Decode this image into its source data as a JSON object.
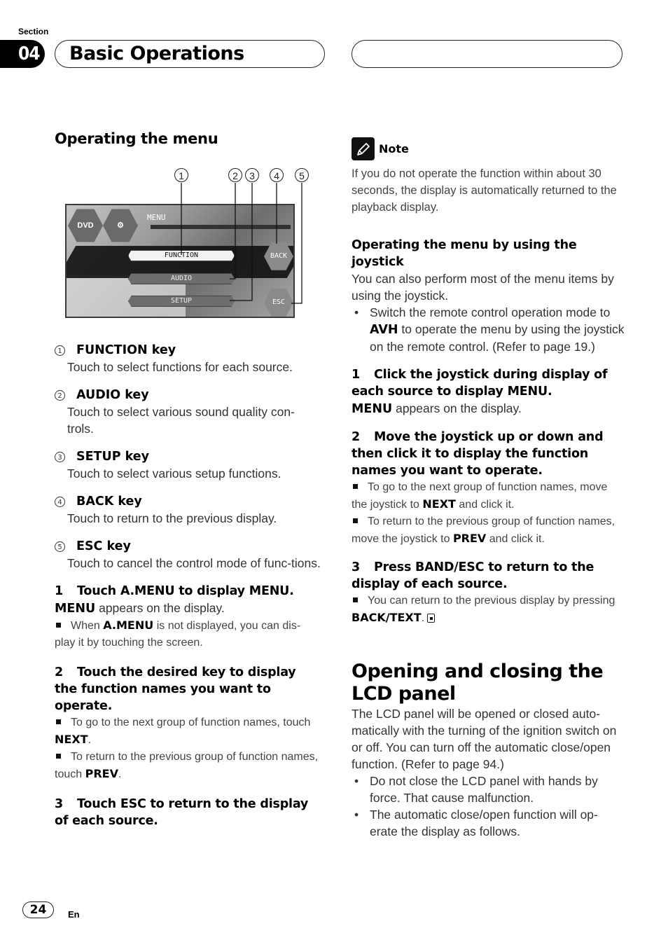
{
  "header": {
    "section_label": "Section",
    "section_number": "04",
    "section_title": "Basic Operations"
  },
  "left": {
    "heading": "Operating the menu",
    "figure": {
      "callouts": [
        "1",
        "2",
        "3",
        "4",
        "5"
      ],
      "screen": {
        "menu_label": "MENU",
        "source_icon_label": "DVD",
        "keys": [
          "FUNCTION",
          "AUDIO",
          "SETUP"
        ],
        "back_label": "BACK",
        "esc_label": "ESC"
      }
    },
    "key_items": [
      {
        "num": "1",
        "title": "FUNCTION key",
        "desc": "Touch to select functions for each source."
      },
      {
        "num": "2",
        "title": "AUDIO key",
        "desc": "Touch to select various sound quality con-trols."
      },
      {
        "num": "3",
        "title": "SETUP key",
        "desc": "Touch to select various setup functions."
      },
      {
        "num": "4",
        "title": "BACK key",
        "desc": "Touch to return to the previous display."
      },
      {
        "num": "5",
        "title": "ESC key",
        "desc": "Touch to cancel the control mode of func-tions."
      }
    ],
    "steps": [
      {
        "n": "1",
        "title": "Touch A.MENU to display MENU.",
        "body_bold": "MENU",
        "body": " appears on the display.",
        "notes": [
          {
            "pre": "When ",
            "bold": "A.MENU",
            "post": " is not displayed, you can dis-play it by touching the screen."
          }
        ]
      },
      {
        "n": "2",
        "title": "Touch the desired key to display the function names you want to operate.",
        "notes": [
          {
            "pre": "To go to the next group of function names, touch ",
            "bold": "NEXT",
            "post": "."
          },
          {
            "pre": "To return to the previous group of function names, touch ",
            "bold": "PREV",
            "post": "."
          }
        ]
      },
      {
        "n": "3",
        "title": "Touch ESC to return to the display of each source."
      }
    ]
  },
  "right": {
    "note": {
      "label": "Note",
      "text": "If you do not operate the function within about 30 seconds, the display is automatically returned to the playback display."
    },
    "joystick": {
      "heading": "Operating the menu by using the joystick",
      "intro": "You can also perform most of the menu items by using the joystick.",
      "bullet": {
        "pre": "Switch the remote control operation mode to ",
        "bold": "AVH",
        "post": " to operate the menu by using the joystick on the remote control. (Refer to page 19.)"
      },
      "steps": [
        {
          "n": "1",
          "title": "Click the joystick during display of each source to display MENU.",
          "body_bold": "MENU",
          "body": " appears on the display."
        },
        {
          "n": "2",
          "title": "Move the joystick up or down and then click it to display the function names you want to operate.",
          "notes": [
            {
              "pre": "To go to the next group of function names, move the joystick to ",
              "bold": "NEXT",
              "post": " and click it."
            },
            {
              "pre": "To return to the previous group of function names, move the joystick to ",
              "bold": "PREV",
              "post": " and click it."
            }
          ]
        },
        {
          "n": "3",
          "title": "Press BAND/ESC to return to the display of each source.",
          "notes": [
            {
              "pre": "You can return to the previous display by pressing ",
              "bold": "BACK/TEXT",
              "post": "."
            }
          ]
        }
      ]
    },
    "lcd": {
      "heading": "Opening and closing the LCD panel",
      "intro": "The LCD panel will be opened or closed auto-matically with the turning of the ignition switch on or off. You can turn off the automatic close/open function. (Refer to page 94.)",
      "bullets": [
        "Do not close the LCD panel with hands by force. That cause malfunction.",
        "The automatic close/open function will op-erate the display as follows."
      ]
    }
  },
  "footer": {
    "page_number": "24",
    "language": "En"
  }
}
